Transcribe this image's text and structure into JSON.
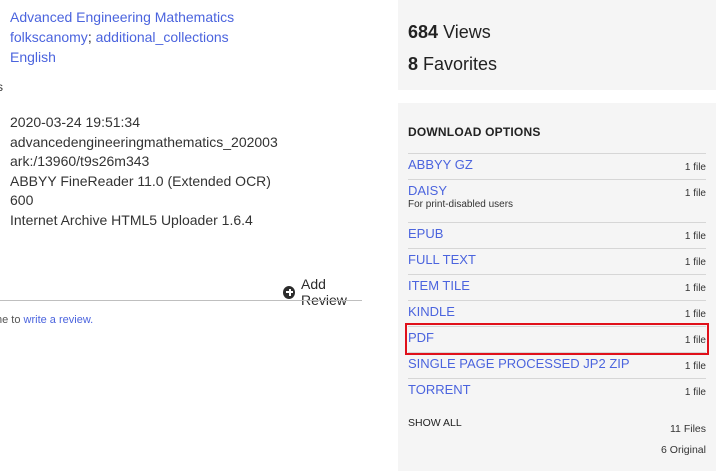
{
  "metadata": {
    "title_link": "Advanced Engineering Mathematics",
    "collections_link_1": "folkscanomy",
    "collections_sep": ";",
    "collections_link_2": "additional_collections",
    "language_link": "English",
    "section_cutoff": "s",
    "values": [
      "2020-03-24 19:51:34",
      "advancedengineeringmathematics_202003",
      "ark:/13960/t9s26m343",
      "ABBYY FineReader 11.0 (Extended OCR)",
      "600",
      "Internet Archive HTML5 Uploader 1.6.4"
    ]
  },
  "reviews": {
    "add_review_label": "Add Review",
    "note_prefix": "ne to",
    "note_link": "write a review."
  },
  "stats": {
    "views_count": "684",
    "views_label": "Views",
    "favorites_count": "8",
    "favorites_label": "Favorites"
  },
  "downloads": {
    "title": "DOWNLOAD OPTIONS",
    "items": [
      {
        "name": "ABBYY GZ",
        "count": "1 file"
      },
      {
        "name": "DAISY",
        "sub": "For print-disabled users",
        "count": "1 file"
      },
      {
        "name": "EPUB",
        "count": "1 file"
      },
      {
        "name": "FULL TEXT",
        "count": "1 file"
      },
      {
        "name": "ITEM TILE",
        "count": "1 file"
      },
      {
        "name": "KINDLE",
        "count": "1 file"
      },
      {
        "name": "PDF",
        "count": "1 file"
      },
      {
        "name": "SINGLE PAGE PROCESSED JP2 ZIP",
        "count": "1 file"
      },
      {
        "name": "TORRENT",
        "count": "1 file"
      }
    ],
    "show_all": "SHOW ALL",
    "files_total": "11 Files",
    "original_total": "6 Original"
  },
  "colors": {
    "link": "#4b64de",
    "highlight": "#e0101a",
    "panel_bg": "#f5f5f5"
  }
}
